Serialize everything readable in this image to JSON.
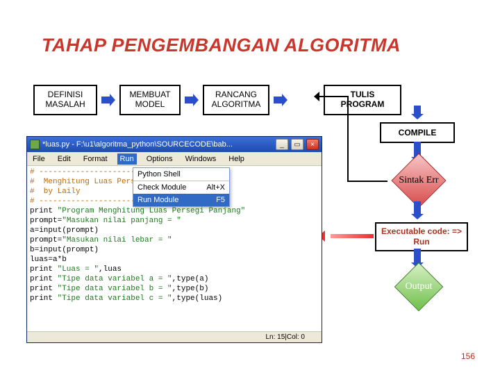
{
  "title": "TAHAP PENGEMBANGAN ALGORITMA",
  "flow": {
    "box1": "DEFINISI MASALAH",
    "box2": "MEMBUAT MODEL",
    "box3": "RANCANG ALGORITMA",
    "box4": "TULIS PROGRAM",
    "compile": "COMPILE",
    "syntax_err": "Sintak Err",
    "exec": "Executable code: => Run",
    "output": "Output"
  },
  "ide": {
    "title": "*luas.py - F:\\u1\\algoritma_python\\SOURCECODE\\bab...",
    "menus": [
      "File",
      "Edit",
      "Format",
      "Run",
      "Options",
      "Windows",
      "Help"
    ],
    "dropdown": [
      {
        "label": "Python Shell",
        "shortcut": ""
      },
      {
        "label": "Check Module",
        "shortcut": "Alt+X"
      },
      {
        "label": "Run Module",
        "shortcut": "F5"
      }
    ],
    "code_lines": [
      "# ----------------------------------",
      "#  Menghitung Luas Persegi Panjang",
      "#  by Laily",
      "# ----------------------------------",
      "print \"Program Menghitung Luas Persegi Panjang\"",
      "prompt=\"Masukan nilai panjang = \"",
      "a=input(prompt)",
      "prompt=\"Masukan nilai lebar = \"",
      "b=input(prompt)",
      "luas=a*b",
      "print \"Luas = \",luas",
      "print \"Tipe data variabel a = \",type(a)",
      "print \"Tipe data variabel b = \",type(b)",
      "print \"Tipe data variabel c = \",type(luas)"
    ],
    "status": "Ln: 15|Col: 0"
  },
  "page_number": "156"
}
